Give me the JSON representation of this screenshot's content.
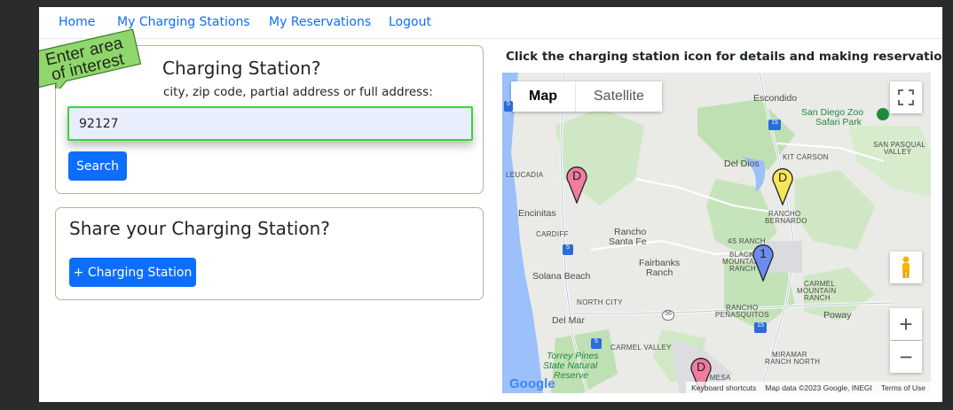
{
  "nav": {
    "home": "Home",
    "stations": "My Charging Stations",
    "reservations": "My Reservations",
    "logout": "Logout"
  },
  "search": {
    "heading": "Charging Station?",
    "hint": "city, zip code, partial address or full address:",
    "value": "92127",
    "button": "Search"
  },
  "callout": {
    "line1": "Enter area",
    "line2": "of interest"
  },
  "share": {
    "heading": "Share your Charging Station?",
    "button": "+ Charging Station"
  },
  "map": {
    "instruction": "Click the charging station icon for details and making reservation.",
    "type_map": "Map",
    "type_satellite": "Satellite",
    "places": {
      "escondido": "Escondido",
      "zoo1": "San Diego Zoo",
      "zoo2": "Safari Park",
      "sanpasqual1": "SAN PASQUAL",
      "sanpasqual2": "VALLEY",
      "kitcarson": "KIT CARSON",
      "deldios": "Del Dios",
      "leucadia": "LEUCADIA",
      "ranchobern1": "RANCHO",
      "ranchobern2": "BERNARDO",
      "encinitas": "Encinitas",
      "cardiff": "CARDIFF",
      "ranchosf1": "Rancho",
      "ranchosf2": "Santa Fe",
      "fourS": "4S RANCH",
      "blackmtn1": "BLACK",
      "blackmtn2": "MOUNTAIN",
      "blackmtn3": "RANCH",
      "fairbanks1": "Fairbanks",
      "fairbanks2": "Ranch",
      "solana": "Solana Beach",
      "carmelmtn1": "CARMEL",
      "carmelmtn2": "MOUNTAIN",
      "carmelmtn3": "RANCH",
      "northcity": "NORTH CITY",
      "ranchopen1": "RANCHO",
      "ranchopen2": "PEÑASQUITOS",
      "poway": "Poway",
      "delmar": "Del Mar",
      "carmelvalley": "CARMEL VALLEY",
      "torrey1": "Torrey Pines",
      "torrey2": "State Natural",
      "torrey3": "Reserve",
      "miramar1": "MIRAMAR",
      "miramar2": "RANCH NORTH",
      "mesa": "A MESA"
    },
    "shields": {
      "i15a": "15",
      "i15b": "15",
      "r56": "56",
      "i5a": "5",
      "i5b": "5",
      "i5c": "5"
    },
    "pins": [
      {
        "label": "D",
        "color": "#f07ca0"
      },
      {
        "label": "D",
        "color": "#f7e65a"
      },
      {
        "label": "1",
        "color": "#6b8cf0"
      },
      {
        "label": "D",
        "color": "#f07ca0"
      }
    ],
    "zoom_in": "+",
    "zoom_out": "−",
    "google": "Google",
    "footer": {
      "shortcuts": "Keyboard shortcuts",
      "data": "Map data ©2023 Google, INEGI",
      "terms": "Terms of Use"
    }
  }
}
